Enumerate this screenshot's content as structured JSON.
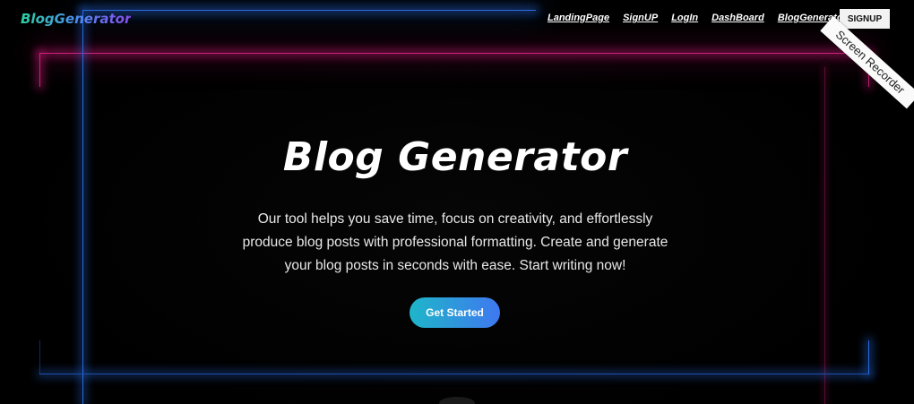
{
  "header": {
    "logo_text": "BlogGenerator",
    "nav": [
      {
        "label": "LandingPage"
      },
      {
        "label": "SignUP"
      },
      {
        "label": "LogIn"
      },
      {
        "label": "DashBoard"
      },
      {
        "label": "BlogGenerator"
      }
    ],
    "signup_button": "SIGNUP"
  },
  "overlay": {
    "recorder_ribbon": "Screen Recorder"
  },
  "hero": {
    "title": "Blog Generator",
    "description": "Our tool helps you save time, focus on creativity, and effortlessly produce blog posts with professional formatting. Create and generate your blog posts in seconds with ease. Start writing now!",
    "cta_label": "Get Started"
  },
  "colors": {
    "background": "#000000",
    "neon_pink": "#d0207a",
    "neon_blue": "#2a6be0",
    "cta_gradient_start": "#1eb6c9",
    "cta_gradient_end": "#3f78f0",
    "logo_gradient": [
      "#2bd1a0",
      "#4c8df0",
      "#8a4bf0"
    ]
  }
}
